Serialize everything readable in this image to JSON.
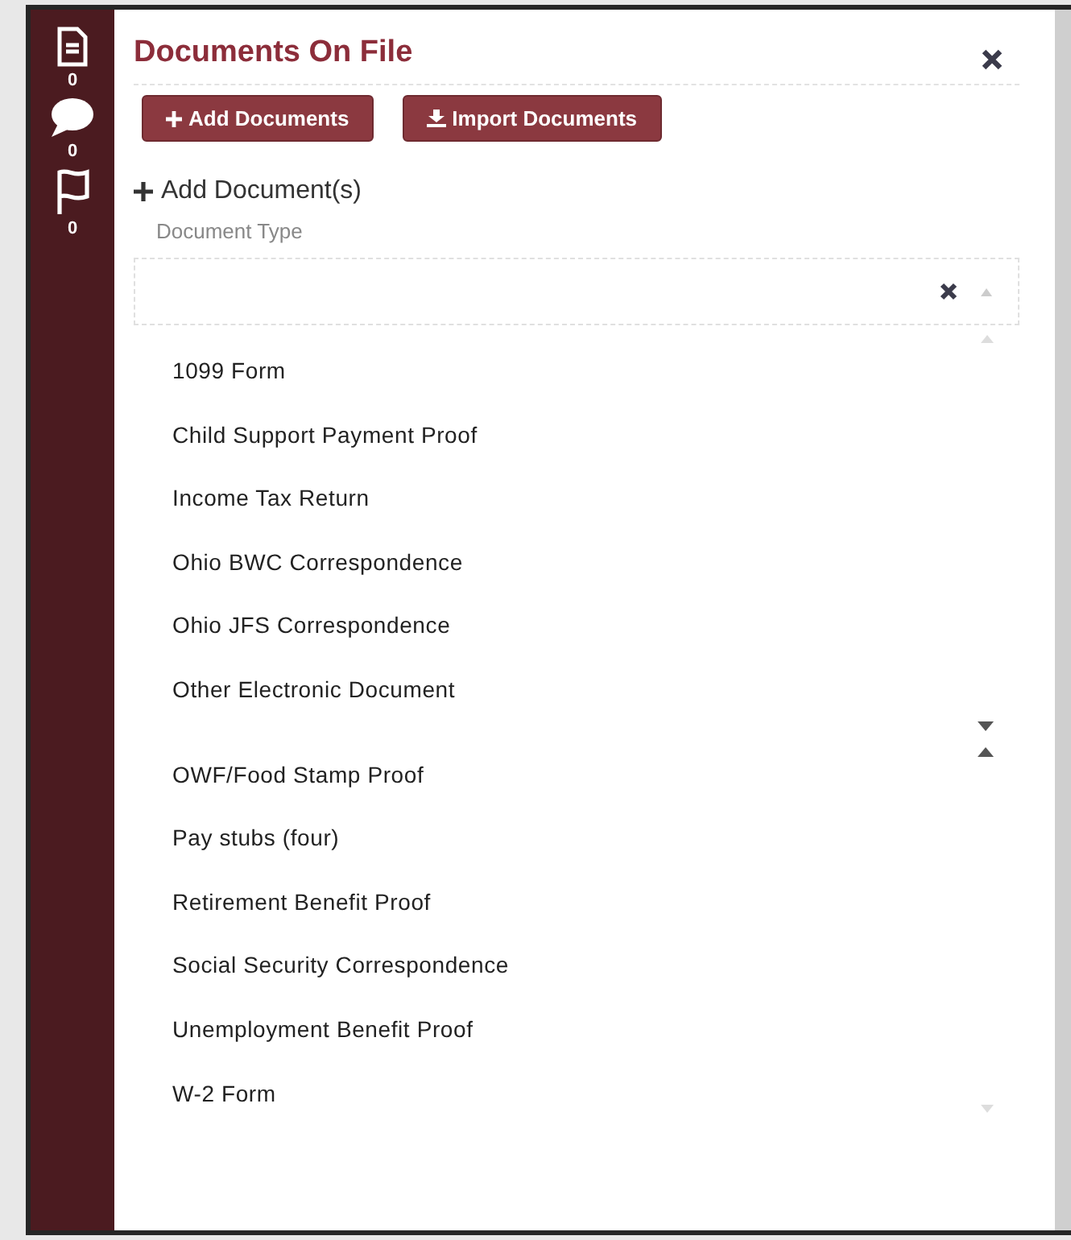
{
  "sidebar": {
    "items": [
      {
        "kind": "document",
        "count": "0"
      },
      {
        "kind": "comment",
        "count": "0"
      },
      {
        "kind": "flag",
        "count": "0"
      }
    ]
  },
  "panel": {
    "title": "Documents On File",
    "buttons": [
      {
        "kind": "add",
        "label": "Add Documents"
      },
      {
        "kind": "import",
        "label": "Import Documents"
      }
    ],
    "section_title": "Add Document(s)",
    "field": {
      "label": "Document Type"
    },
    "option_groups": [
      [
        "1099 Form",
        "Child Support Payment Proof",
        "Income Tax Return",
        "Ohio BWC Correspondence",
        "Ohio JFS Correspondence",
        "Other Electronic Document"
      ],
      [
        "OWF/Food Stamp Proof",
        "Pay stubs (four)",
        "Retirement Benefit Proof",
        "Social Security Correspondence",
        "Unemployment Benefit Proof",
        "W-2 Form"
      ]
    ]
  }
}
